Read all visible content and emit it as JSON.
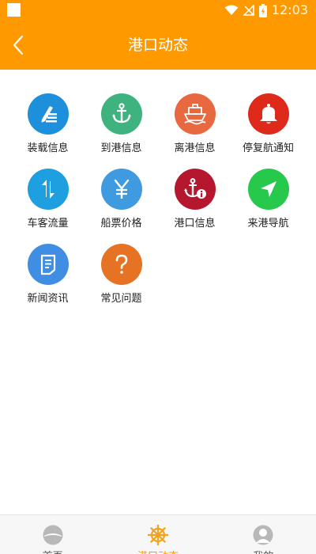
{
  "status_bar": {
    "time": "12:03"
  },
  "header": {
    "title": "港口动态"
  },
  "colors": {
    "accent": "#ff9900"
  },
  "grid": [
    [
      {
        "label": "装载信息",
        "icon": "pen-lines-icon",
        "color": "#1d8fdb"
      },
      {
        "label": "到港信息",
        "icon": "anchor-icon",
        "color": "#3fb37f"
      },
      {
        "label": "离港信息",
        "icon": "ship-icon",
        "color": "#e8693f"
      },
      {
        "label": "停复航通知",
        "icon": "bell-icon",
        "color": "#dd2a1b"
      }
    ],
    [
      {
        "label": "车客流量",
        "icon": "swap-arrows-icon",
        "color": "#1d9fe0"
      },
      {
        "label": "船票价格",
        "icon": "yen-icon",
        "color": "#3f9ae0"
      },
      {
        "label": "港口信息",
        "icon": "anchor-info-icon",
        "color": "#b5182e"
      },
      {
        "label": "来港导航",
        "icon": "navigation-icon",
        "color": "#27c94c"
      }
    ],
    [
      {
        "label": "新闻资讯",
        "icon": "news-doc-icon",
        "color": "#3f8ee3"
      },
      {
        "label": "常见问题",
        "icon": "question-icon",
        "color": "#e67323"
      }
    ]
  ],
  "tabs": [
    {
      "label": "首页",
      "icon": "home-icon",
      "active": false
    },
    {
      "label": "港口动态",
      "icon": "helm-icon",
      "active": true
    },
    {
      "label": "我的",
      "icon": "user-icon",
      "active": false
    }
  ]
}
